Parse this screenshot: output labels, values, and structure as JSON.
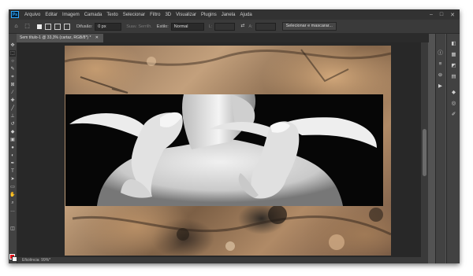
{
  "menu": {
    "logo": "Ps",
    "items": [
      "Arquivo",
      "Editar",
      "Imagem",
      "Camada",
      "Texto",
      "Selecionar",
      "Filtro",
      "3D",
      "Visualizar",
      "Plugins",
      "Janela",
      "Ajuda"
    ],
    "window_controls": [
      "–",
      "□",
      "✕"
    ]
  },
  "options": {
    "difusao_label": "Difusão:",
    "difusao_value": "0 px",
    "suav_label": "Suav. Serrilh.",
    "estilo_label": "Estilo:",
    "estilo_value": "Normal",
    "l_label": "L:",
    "a_label": "A:",
    "select_mask_button": "Selecionar e mascarar..."
  },
  "document": {
    "tab_title": "Sem título-1 @ 33,3% (cartaz, RGB/8*) *"
  },
  "status": {
    "text": "Eficiência: 99%*"
  },
  "colors": {
    "foreground": "#e8101a",
    "background": "#ffffff"
  },
  "icons": {
    "tools": [
      "move-icon",
      "marquee-icon",
      "lasso-icon",
      "quick-select-icon",
      "crop-icon",
      "frame-icon",
      "eyedropper-icon",
      "healing-icon",
      "brush-icon",
      "stamp-icon",
      "history-brush-icon",
      "eraser-icon",
      "gradient-icon",
      "blur-icon",
      "dodge-icon",
      "pen-icon",
      "type-icon",
      "path-select-icon",
      "shape-icon",
      "hand-icon",
      "zoom-icon",
      "more-tools-icon"
    ],
    "panel_col1": [
      "info-icon",
      "properties-icon",
      "adjust-icon",
      "play-icon"
    ],
    "panel_col2": [
      "color-icon",
      "swatches-icon",
      "gradients-icon",
      "patterns-icon",
      "layers-icon",
      "channels-icon",
      "paths-icon"
    ]
  }
}
